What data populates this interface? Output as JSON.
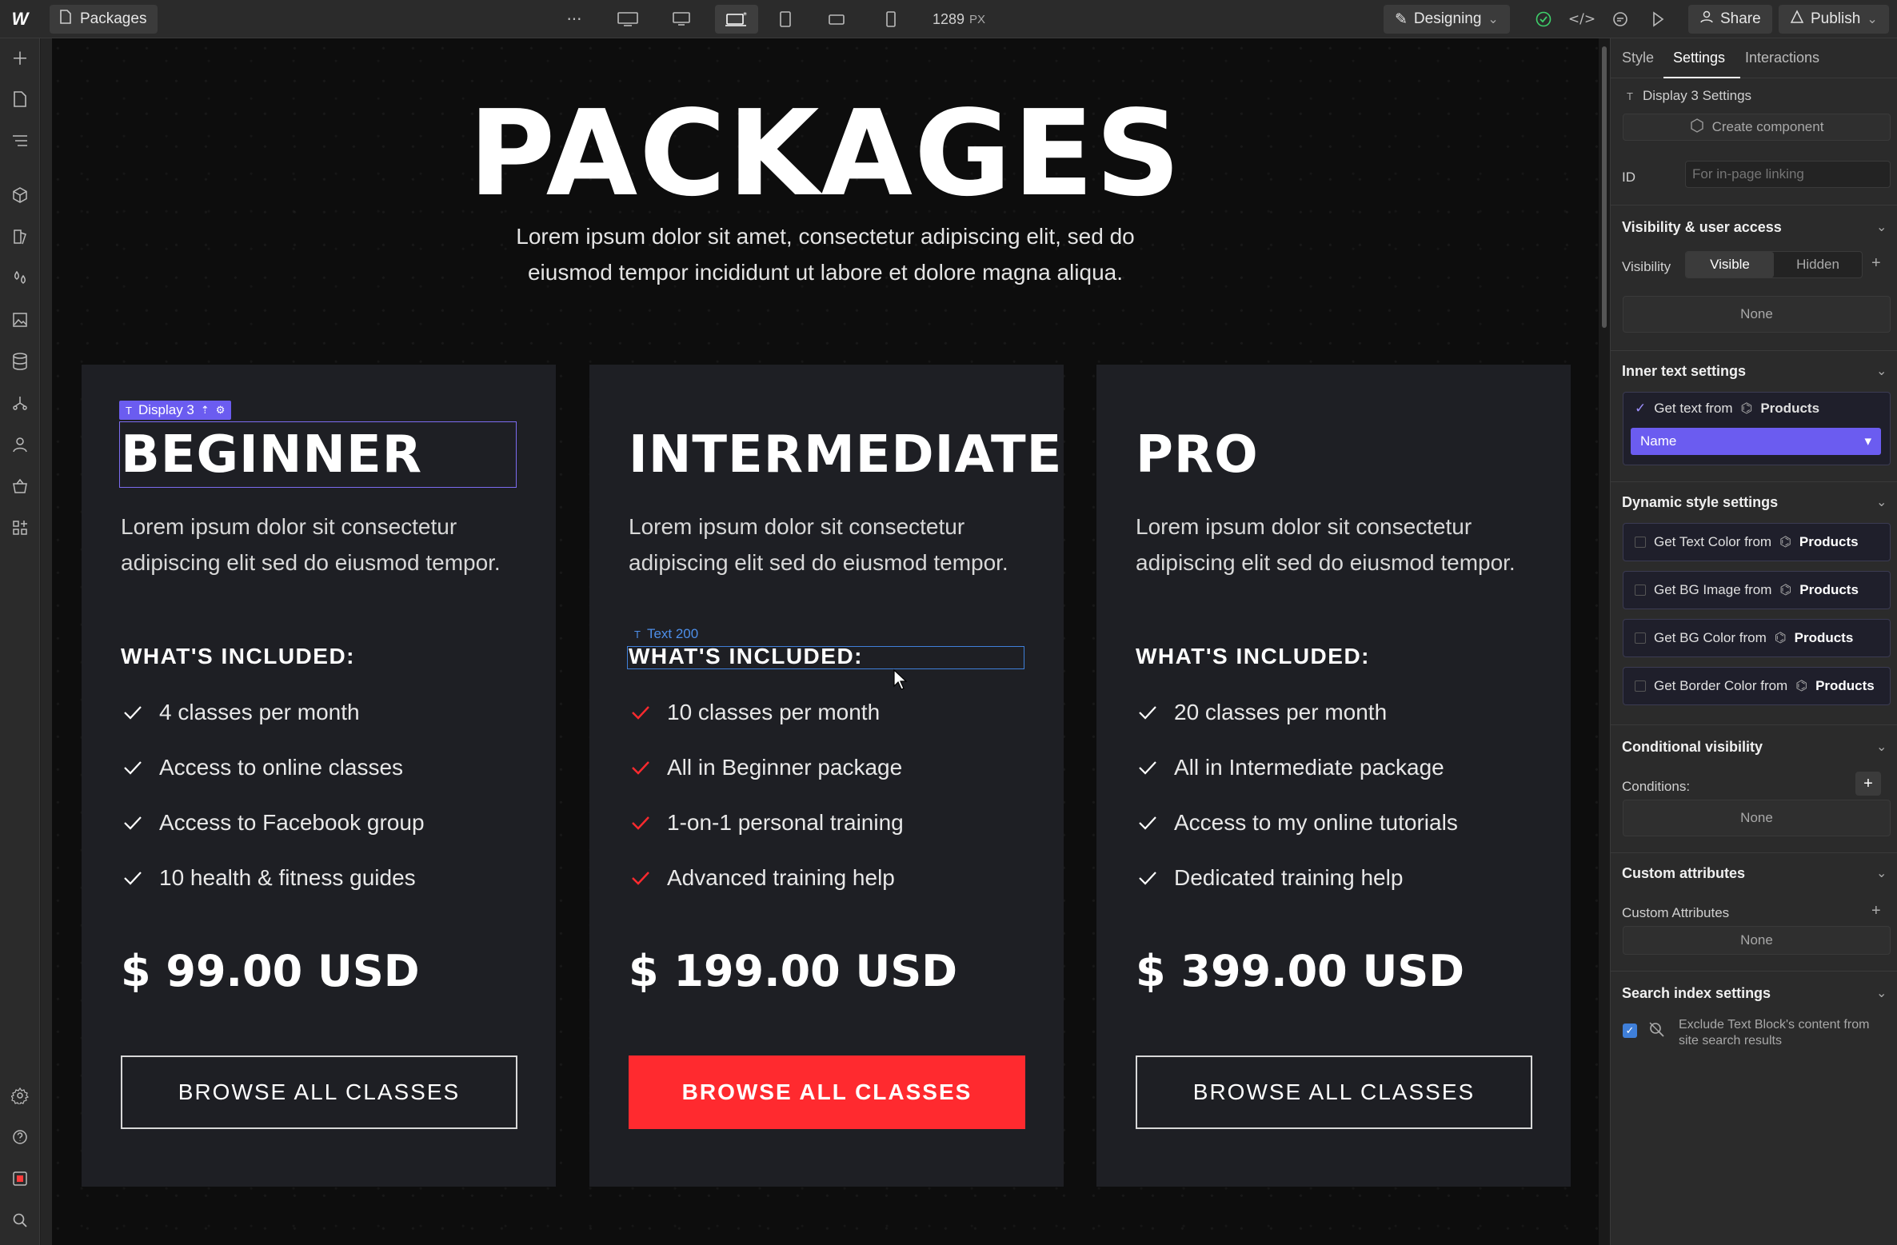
{
  "topbar": {
    "logo": "W",
    "page_name": "Packages",
    "more": "···",
    "width_value": "1289",
    "width_unit": "PX",
    "mode_label": "Designing",
    "share_label": "Share",
    "publish_label": "Publish"
  },
  "canvas": {
    "hero_title": "PACKAGES",
    "hero_subtitle": "Lorem ipsum dolor sit amet, consectetur adipiscing elit, sed do eiusmod tempor incididunt ut labore et dolore magna aliqua.",
    "selection_tag": "Display 3",
    "hover_tag": "Text 200",
    "cards": [
      {
        "title": "BEGINNER",
        "description": "Lorem ipsum dolor sit consectetur adipiscing elit sed do eiusmod tempor.",
        "included_label": "WHAT'S INCLUDED:",
        "features": [
          "4 classes per month",
          "Access to online classes",
          "Access to Facebook group",
          "10 health & fitness guides"
        ],
        "price": "$ 99.00 USD",
        "cta": "BROWSE ALL CLASSES",
        "accent": "#ffffff"
      },
      {
        "title": "INTERMEDIATE",
        "description": "Lorem ipsum dolor sit consectetur adipiscing elit sed do eiusmod tempor.",
        "included_label": "WHAT'S INCLUDED:",
        "features": [
          "10 classes per month",
          "All in Beginner package",
          "1-on-1 personal training",
          "Advanced training help"
        ],
        "price": "$ 199.00 USD",
        "cta": "BROWSE ALL CLASSES",
        "accent": "#ff2a2f"
      },
      {
        "title": "PRO",
        "description": "Lorem ipsum dolor sit consectetur adipiscing elit sed do eiusmod tempor.",
        "included_label": "WHAT'S INCLUDED:",
        "features": [
          "20 classes per month",
          "All in Intermediate package",
          "Access to my online tutorials",
          "Dedicated training help"
        ],
        "price": "$ 399.00 USD",
        "cta": "BROWSE ALL CLASSES",
        "accent": "#ffffff"
      }
    ]
  },
  "panel": {
    "tabs": [
      "Style",
      "Settings",
      "Interactions"
    ],
    "active_tab": "Settings",
    "element_settings_title": "Display 3 Settings",
    "create_component": "Create component",
    "id_label": "ID",
    "id_placeholder": "For in-page linking",
    "visibility_section": "Visibility & user access",
    "visibility_label": "Visibility",
    "visibility_visible": "Visible",
    "visibility_hidden": "Hidden",
    "visibility_none": "None",
    "inner_text_section": "Inner text settings",
    "get_text_from": "Get text from",
    "source_collection": "Products",
    "field_selected": "Name",
    "dynamic_style_section": "Dynamic style settings",
    "dynamic_items": [
      "Get Text Color from",
      "Get BG Image from",
      "Get BG Color from",
      "Get Border Color from"
    ],
    "conditional_section": "Conditional visibility",
    "conditions_label": "Conditions:",
    "conditions_none": "None",
    "custom_attr_section": "Custom attributes",
    "custom_attr_label": "Custom Attributes",
    "custom_attr_none": "None",
    "search_index_section": "Search index settings",
    "search_index_text": "Exclude Text Block's content from site search results"
  },
  "colors": {
    "accent_red": "#ff2a2f",
    "selection_purple": "#6b5cf0",
    "hover_blue": "#3f7fd9"
  }
}
